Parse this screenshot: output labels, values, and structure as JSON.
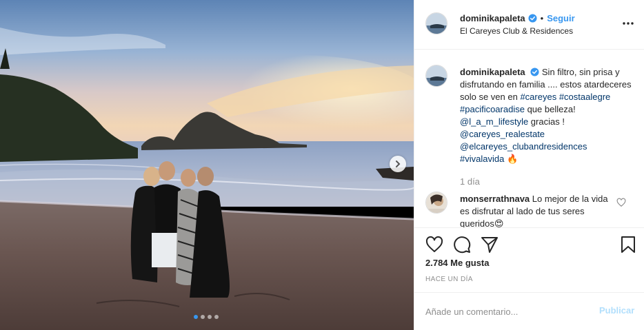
{
  "post": {
    "username": "dominikapaleta",
    "follow_label": "Seguir",
    "separator": "•",
    "location": "El Careyes Club & Residences"
  },
  "caption": {
    "username": "dominikapaleta",
    "text_1": "Sin filtro, sin prisa y disfrutando en familia .... estos atardeceres solo se ven en ",
    "tag_1": "#careyes",
    "space_1": " ",
    "tag_2": "#costaalegre",
    "space_2": " ",
    "tag_3": "#pacificoaradise",
    "text_2": " que belleza! ",
    "tag_4": "@l_a_m_lifestyle",
    "text_3": " gracias ! ",
    "tag_5": "@careyes_realestate",
    "space_3": " ",
    "tag_6": "@elcareyes_clubandresidences",
    "space_4": " ",
    "tag_7": "#vivalavida",
    "emoji": " 🔥",
    "time": "1 día"
  },
  "comment": {
    "username": "monserrathnava",
    "text": "Lo mejor de la vida es disfrutar al lado de tus seres queridos😍"
  },
  "likes": "2.784 Me gusta",
  "posted_ago": "Hace un día",
  "add_comment": {
    "placeholder": "Añade un comentario...",
    "publish_label": "Publicar"
  },
  "carousel": {
    "total": 4,
    "active": 1
  },
  "colors": {
    "accent": "#3897f0",
    "hashtag": "#003569",
    "muted": "#8e8e8e",
    "publish_disabled": "#b2dffc"
  },
  "icons": [
    "verified-icon",
    "more-options-icon",
    "heart-icon",
    "comment-icon",
    "share-icon",
    "bookmark-icon",
    "chevron-right-icon"
  ]
}
